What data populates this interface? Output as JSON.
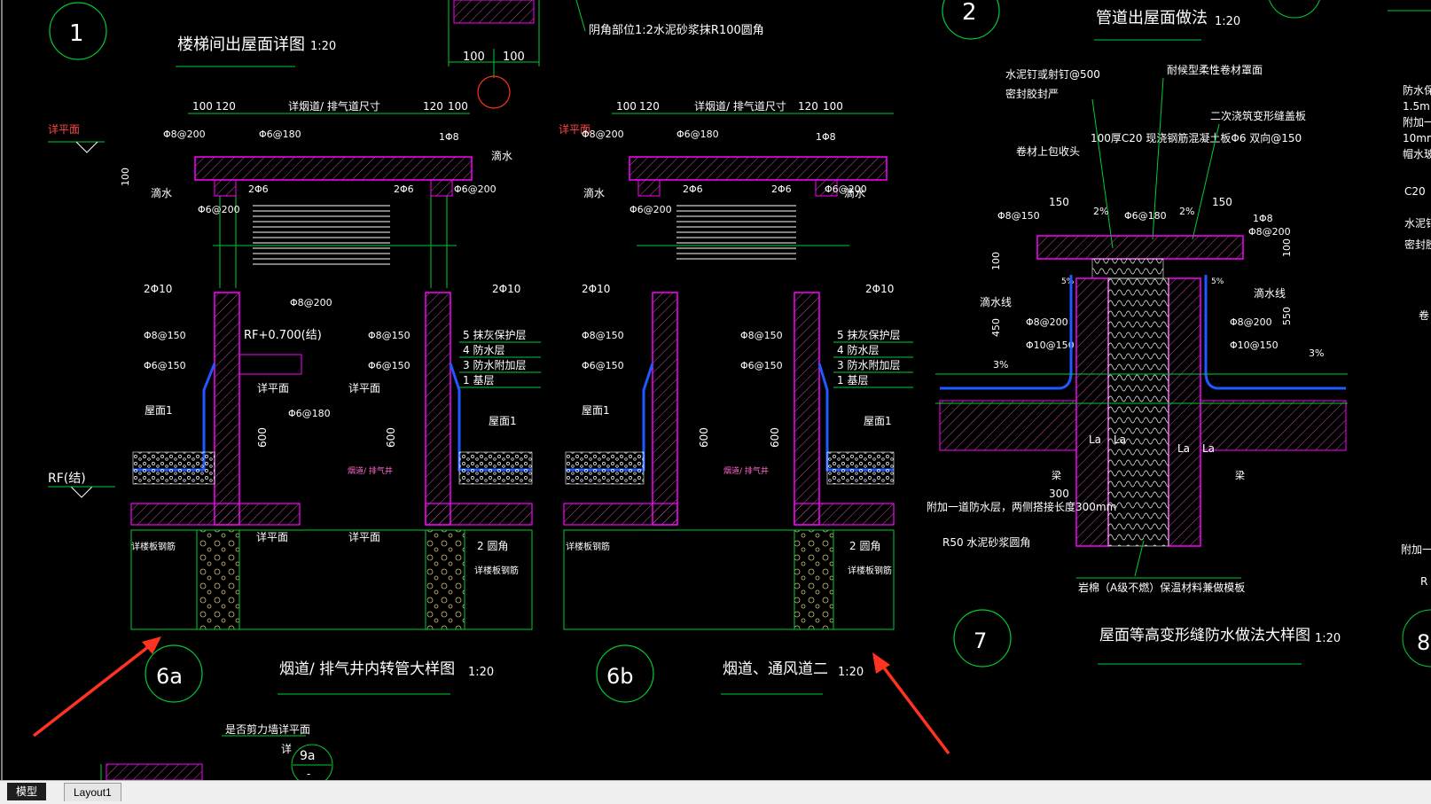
{
  "tabs": {
    "model": "模型",
    "layout1": "Layout1"
  },
  "drawing": {
    "d1": {
      "num": "1",
      "title": "楼梯间出屋面详图",
      "scale": "1:20"
    },
    "d2": {
      "num": "2",
      "title": "管道出屋面做法",
      "scale": "1:20"
    },
    "d6a": {
      "num": "6a",
      "title": "烟道/ 排气井内转管大样图",
      "scale": "1:20"
    },
    "d6b": {
      "num": "6b",
      "title": "烟道、通风道二",
      "scale": "1:20"
    },
    "d7": {
      "num": "7",
      "title": "屋面等高变形缝防水做法大样图",
      "scale": "1:20"
    },
    "d8": {
      "num": "8"
    },
    "d9a": {
      "num": "9a",
      "sub": "-",
      "title": "是否剪力墙详平面",
      "detail": "详"
    },
    "top_note": "阴角部位1:2水泥砂浆抹R100圆角",
    "dim_100": "100",
    "dim_120": "120",
    "dim_flue": "详烟道/ 排气道尺寸",
    "dim_600": "600",
    "plan": "详平面",
    "rf": "RF(结)",
    "rf_elev": "RF+0.700(结)",
    "roof1": "屋面1",
    "flue": "烟道/ 排气井",
    "drip": "滴水",
    "r_phi6_200": "Φ6@200",
    "r_phi6_180": "Φ6@180",
    "r_phi6_150": "Φ6@150",
    "r_phi8_200": "Φ8@200",
    "r_phi8_150": "Φ8@150",
    "r_phi10_150": "Φ10@150",
    "r_1phi8": "1Φ8",
    "r_2phi6": "2Φ6",
    "r_2phi10": "2Φ10",
    "layer5": "5  抹灰保护层",
    "layer4": "4  防水层",
    "layer3": "3  防水附加层",
    "layer1": "1  基层",
    "fillet": "2  圆角",
    "slab_bar": "详楼板钢筋",
    "d7_labels": {
      "nail": "水泥钉或射钉@500",
      "seal": "密封胶封严",
      "cap": "耐候型柔性卷材罩面",
      "cover": "二次浇筑变形缝盖板",
      "slab": "100厚C20 现浇钢筋混凝土板Φ6 双向@150",
      "wrap": "卷材上包收头",
      "drip_line": "滴水线",
      "slope": "2%",
      "slope3": "3%",
      "slope5": "5%",
      "d150": "150",
      "d100": "100",
      "d450": "450",
      "d550": "550",
      "d300": "300",
      "la": "La",
      "beam": "梁",
      "extra": "附加一道防水层，两侧搭接长度300mm",
      "r50": "R50 水泥砂浆圆角",
      "rockwool": "岩棉（A级不燃）保温材料兼做模板"
    },
    "right_edge": [
      "防水保",
      "1.5m",
      "附加一",
      "10mm",
      "帽水玻",
      "C20",
      "水泥钉",
      "密封胶",
      "卷",
      "附加一",
      "R"
    ]
  },
  "colors": {
    "bg": "#000000",
    "line": "#00ff00",
    "text": "#ffffff",
    "hatch": "#ff00ff",
    "water": "#1e5aff",
    "arrow": "#ff3322",
    "fill": "#3a1420"
  }
}
